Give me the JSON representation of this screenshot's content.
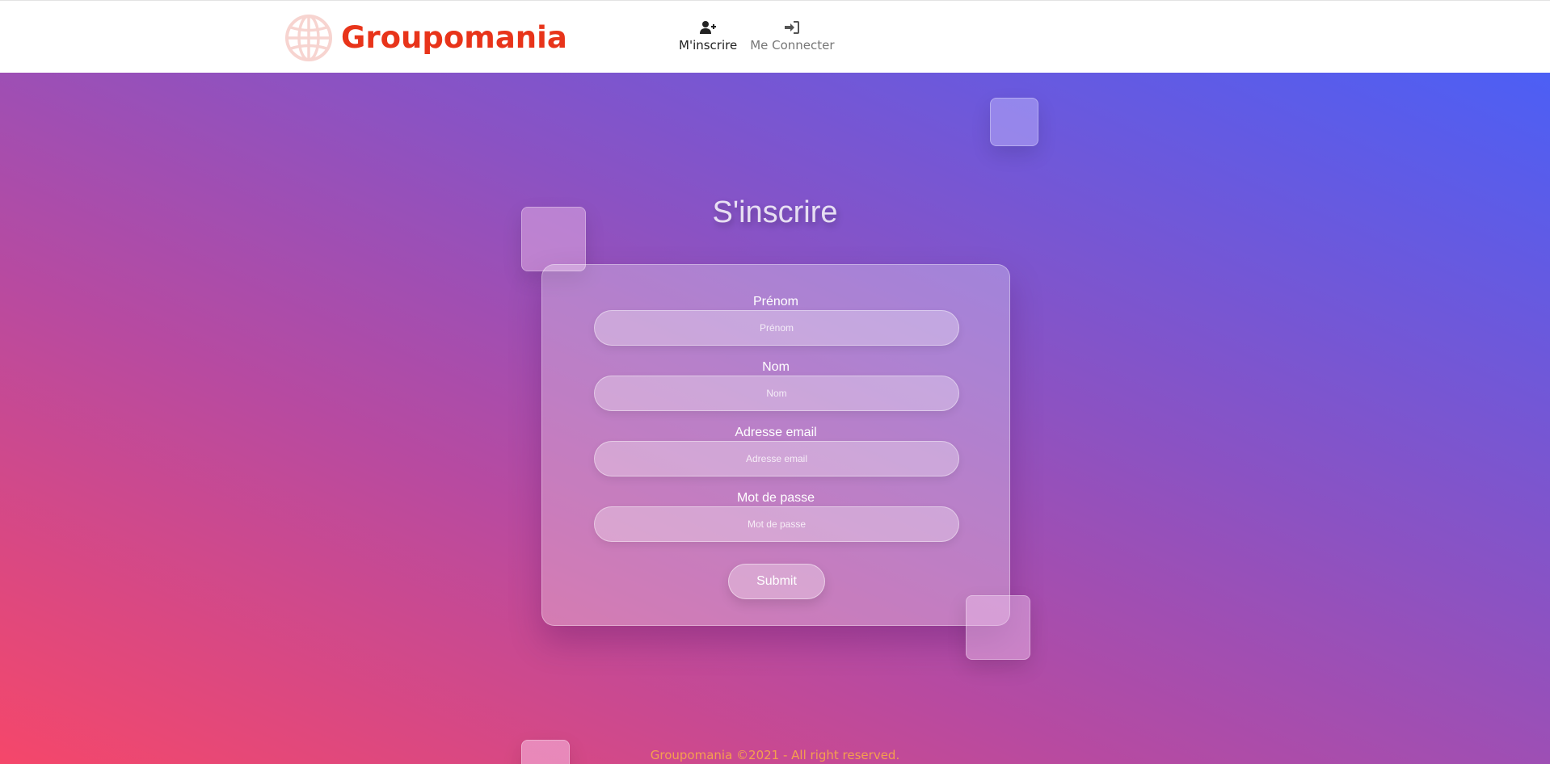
{
  "brand": {
    "name": "Groupomania",
    "color": "#e8341a",
    "icon": "globe-icon"
  },
  "nav": {
    "signup": {
      "label": "M'inscrire",
      "icon": "user-plus-icon",
      "active": true
    },
    "login": {
      "label": "Me Connecter",
      "icon": "sign-in-icon",
      "active": false
    }
  },
  "page": {
    "title": "S'inscrire"
  },
  "form": {
    "firstname": {
      "label": "Prénom",
      "placeholder": "Prénom"
    },
    "lastname": {
      "label": "Nom",
      "placeholder": "Nom"
    },
    "email": {
      "label": "Adresse email",
      "placeholder": "Adresse email"
    },
    "password": {
      "label": "Mot de passe",
      "placeholder": "Mot de passe"
    },
    "submit_label": "Submit"
  },
  "footer": {
    "text": "Groupomania ©2021 - All right reserved."
  },
  "colors": {
    "gradient_start": "#f5476a",
    "gradient_mid": "#b84aa0",
    "gradient_end": "#4c5ff5",
    "footer_text": "#f5a04e"
  }
}
